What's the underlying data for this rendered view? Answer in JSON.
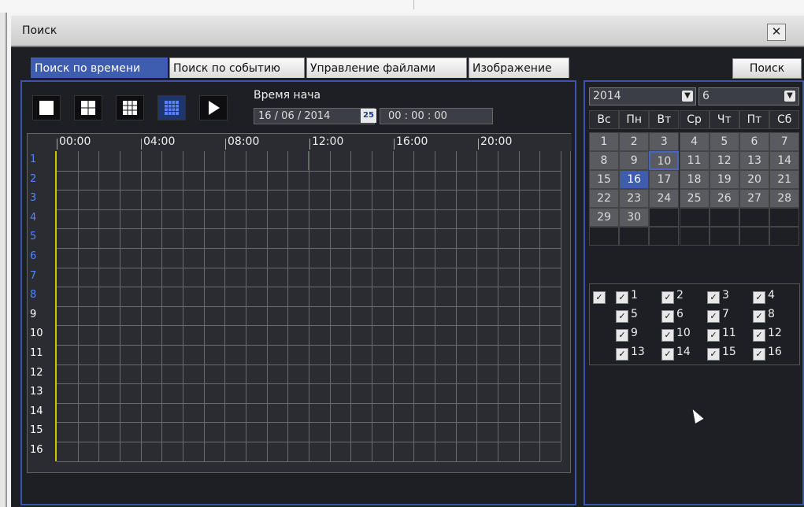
{
  "window": {
    "title": "Поиск",
    "close_label": "✕"
  },
  "tabs": [
    {
      "label": "Поиск по времени"
    },
    {
      "label": "Поиск по событию"
    },
    {
      "label": "Управление файлами"
    },
    {
      "label": "Изображение"
    }
  ],
  "search_button": "Поиск",
  "start_time": {
    "label": "Время нача",
    "date": "16 / 06 / 2014",
    "calendar_icon_label": "25",
    "time": "00  :  00  :  00"
  },
  "timeline": {
    "hours": [
      "00:00",
      "04:00",
      "08:00",
      "12:00",
      "16:00",
      "20:00"
    ],
    "channels": [
      "1",
      "2",
      "3",
      "4",
      "5",
      "6",
      "7",
      "8",
      "9",
      "10",
      "11",
      "12",
      "13",
      "14",
      "15",
      "16"
    ]
  },
  "calendar": {
    "year": "2014",
    "month": "6",
    "weekdays": [
      "Вс",
      "Пн",
      "Вт",
      "Ср",
      "Чт",
      "Пт",
      "Сб"
    ],
    "days": [
      "1",
      "2",
      "3",
      "4",
      "5",
      "6",
      "7",
      "8",
      "9",
      "10",
      "11",
      "12",
      "13",
      "14",
      "15",
      "16",
      "17",
      "18",
      "19",
      "20",
      "21",
      "22",
      "23",
      "24",
      "25",
      "26",
      "27",
      "28",
      "29",
      "30"
    ],
    "today": "10",
    "selected": "16"
  },
  "channel_checks": [
    "",
    "1",
    "2",
    "3",
    "4",
    "5",
    "6",
    "7",
    "8",
    "9",
    "10",
    "11",
    "12",
    "13",
    "14",
    "15",
    "16"
  ],
  "colors": {
    "accent": "#3f5db0",
    "panel_border": "#3a56a8",
    "grid_marker": "#d8c100"
  }
}
